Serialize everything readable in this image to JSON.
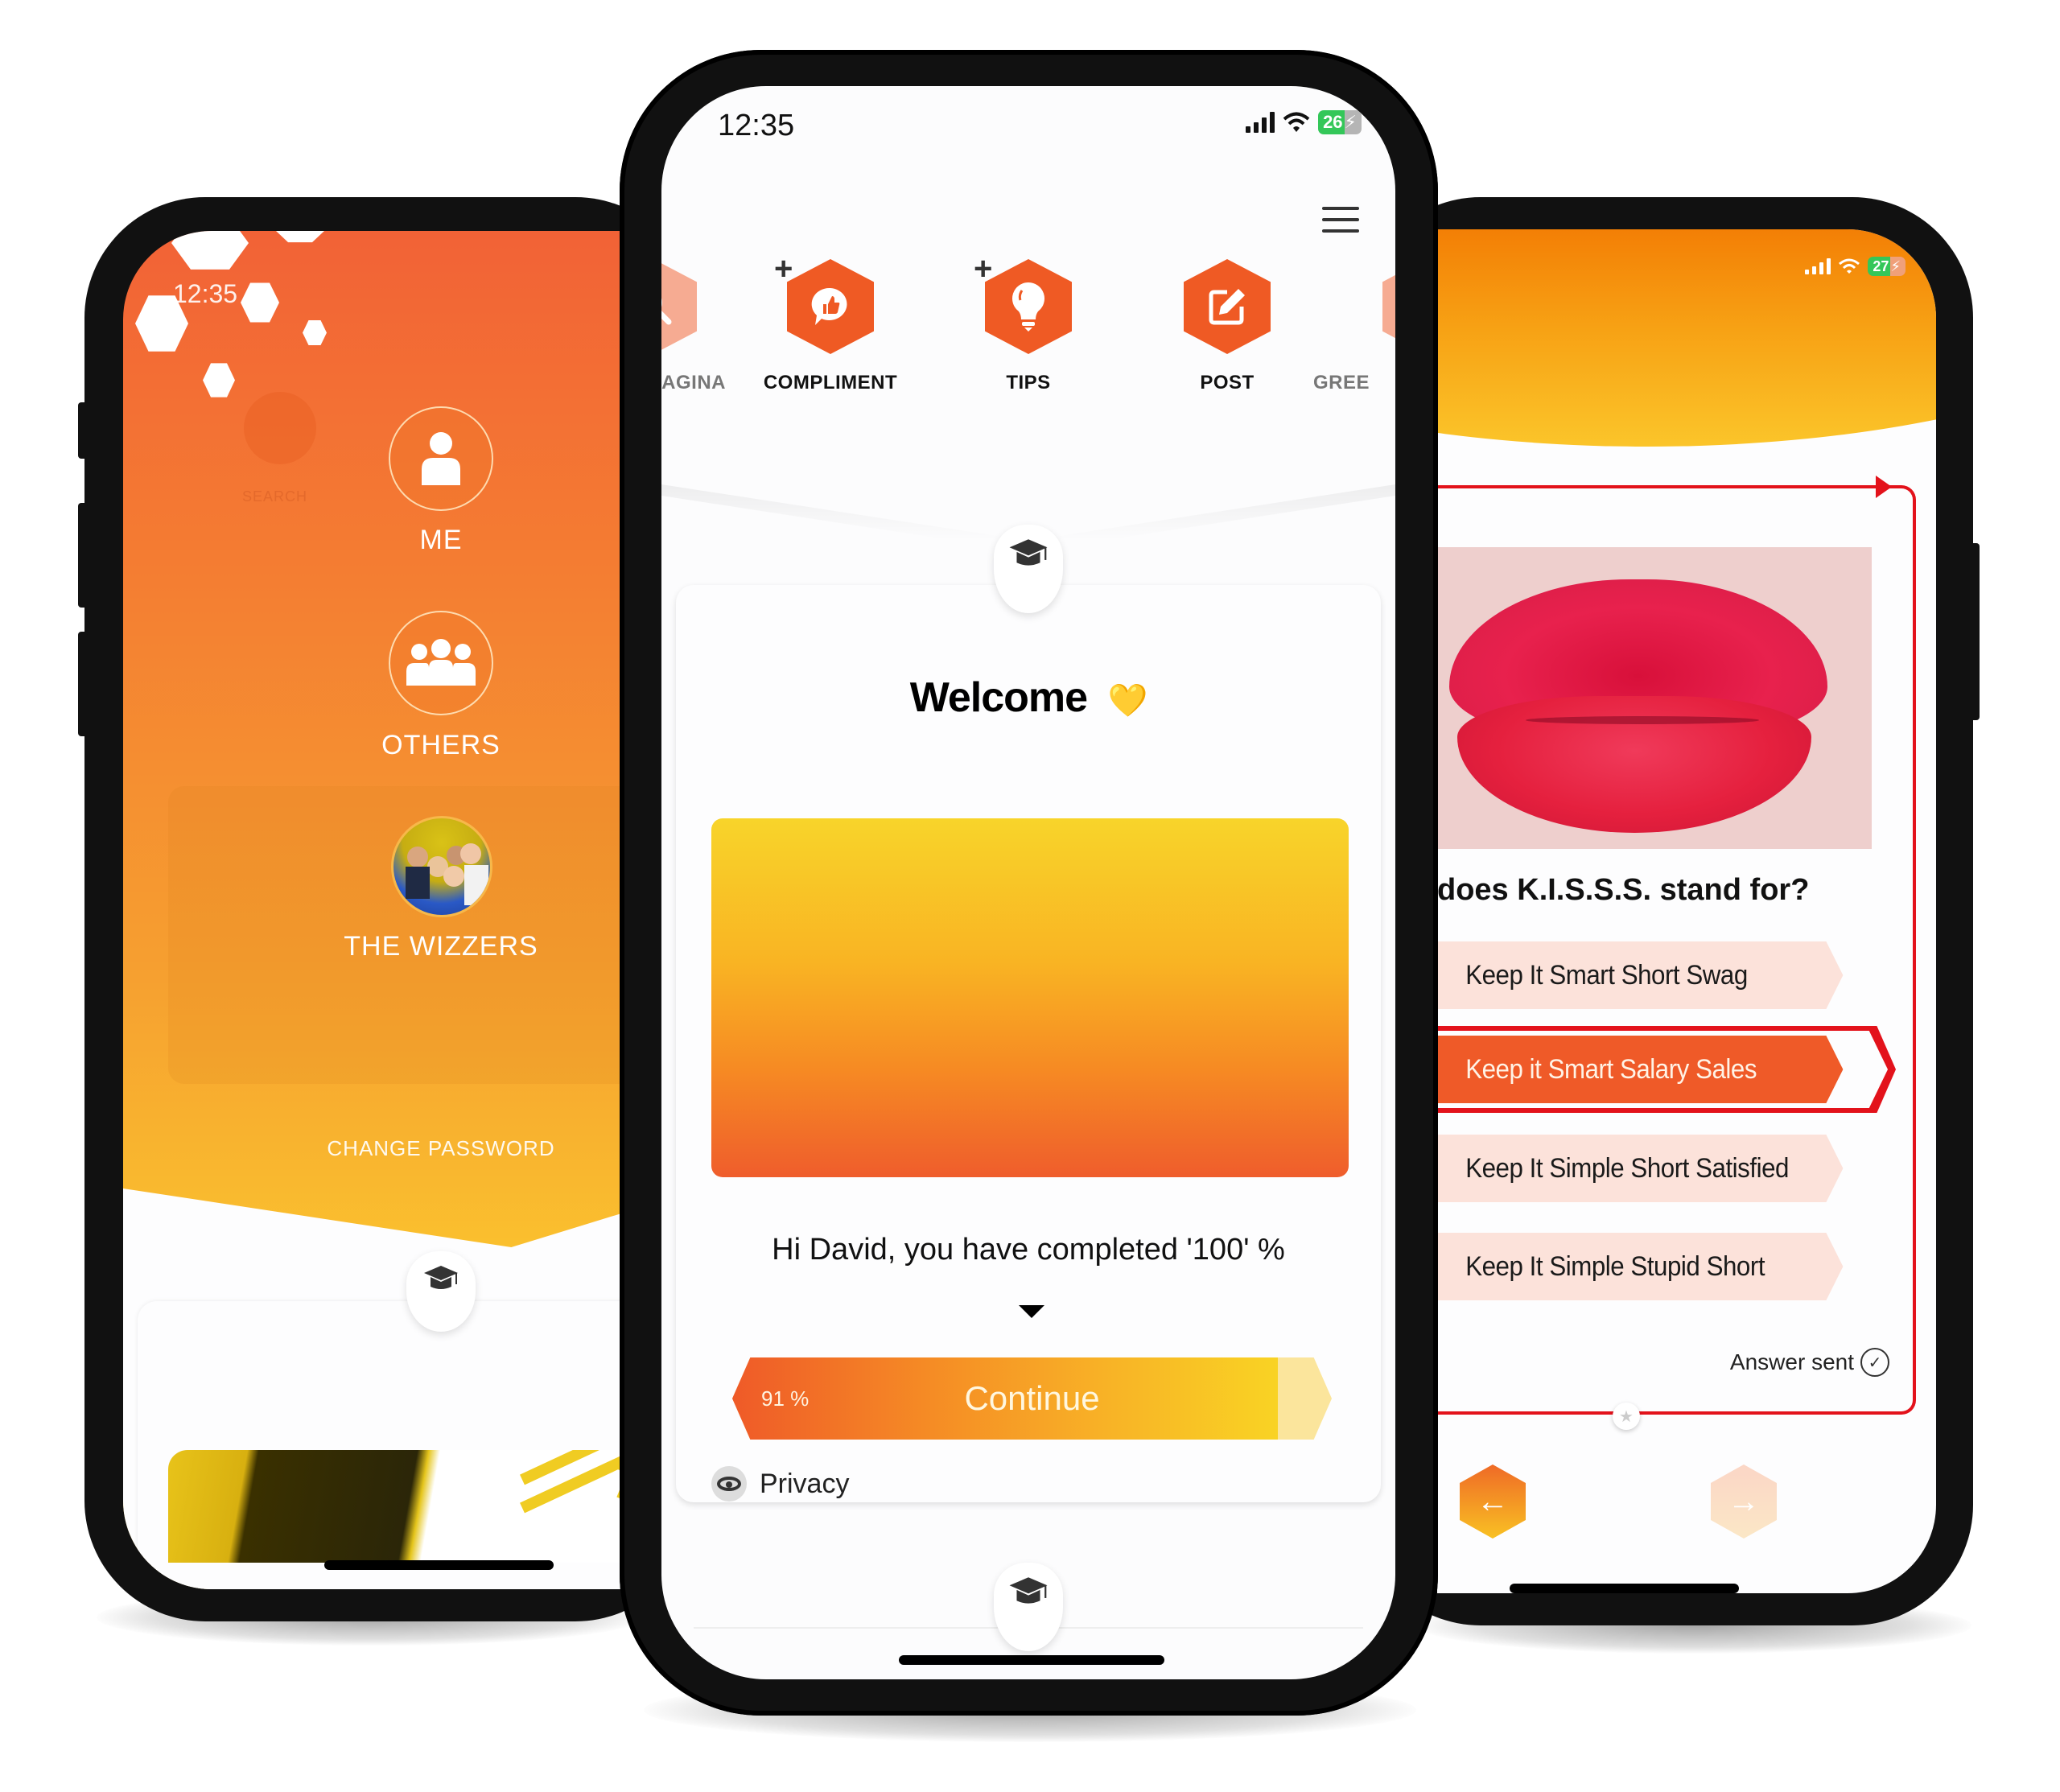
{
  "left_phone": {
    "status_time": "12:35",
    "ghost_items": [
      {
        "label": "SEARCH"
      }
    ],
    "menu": [
      {
        "label": "ME",
        "icon": "person-icon"
      },
      {
        "label": "OTHERS",
        "icon": "group-icon"
      },
      {
        "label": "THE WIZZERS",
        "icon": "group-photo-avatar"
      }
    ],
    "change_password": "CHANGE PASSWORD",
    "colors": {
      "gradient_top": "#f26236",
      "gradient_bottom": "#fdd22f"
    }
  },
  "center_phone": {
    "status": {
      "time": "12:35",
      "battery": "26",
      "battery_charging": true
    },
    "icon_row": [
      {
        "label": "AGINA",
        "icon": "search-icon",
        "faded": true,
        "has_plus": false
      },
      {
        "label": "COMPLIMENT",
        "icon": "thumbs-up-chat-icon",
        "faded": false,
        "has_plus": true
      },
      {
        "label": "TIPS",
        "icon": "lightbulb-icon",
        "faded": false,
        "has_plus": true
      },
      {
        "label": "POST",
        "icon": "edit-icon",
        "faded": false,
        "has_plus": false
      },
      {
        "label": "GREE",
        "icon": "unknown-icon",
        "faded": true,
        "has_plus": false
      }
    ],
    "plus_symbol": "+",
    "welcome_title": "Welcome",
    "welcome_emoji": "💛",
    "greeting": "Hi David, you have completed '100' %",
    "continue": {
      "label": "Continue",
      "progress_label": "91 %",
      "progress": 0.91
    },
    "privacy_label": "Privacy",
    "colors": {
      "accent": "#ef5a24",
      "accent_faded": "#f6ab92"
    }
  },
  "right_phone": {
    "status": {
      "battery": "27",
      "battery_charging": true
    },
    "question": "does K.I.S.S.S. stand for?",
    "answers": [
      {
        "label": "Keep It Smart Short Swag",
        "selected": false
      },
      {
        "label": "Keep it Smart Salary Sales",
        "selected": true
      },
      {
        "label": "Keep It Simple Short Satisfied",
        "selected": false
      },
      {
        "label": "Keep It Simple Stupid Short",
        "selected": false
      }
    ],
    "answer_sent": "Answer sent",
    "nav": {
      "prev_icon": "arrow-left-icon",
      "next_icon": "arrow-right-icon",
      "next_enabled": false
    },
    "colors": {
      "frame_red": "#e3121b",
      "selected": "#ef5a28",
      "unselected": "#fce2da"
    }
  }
}
